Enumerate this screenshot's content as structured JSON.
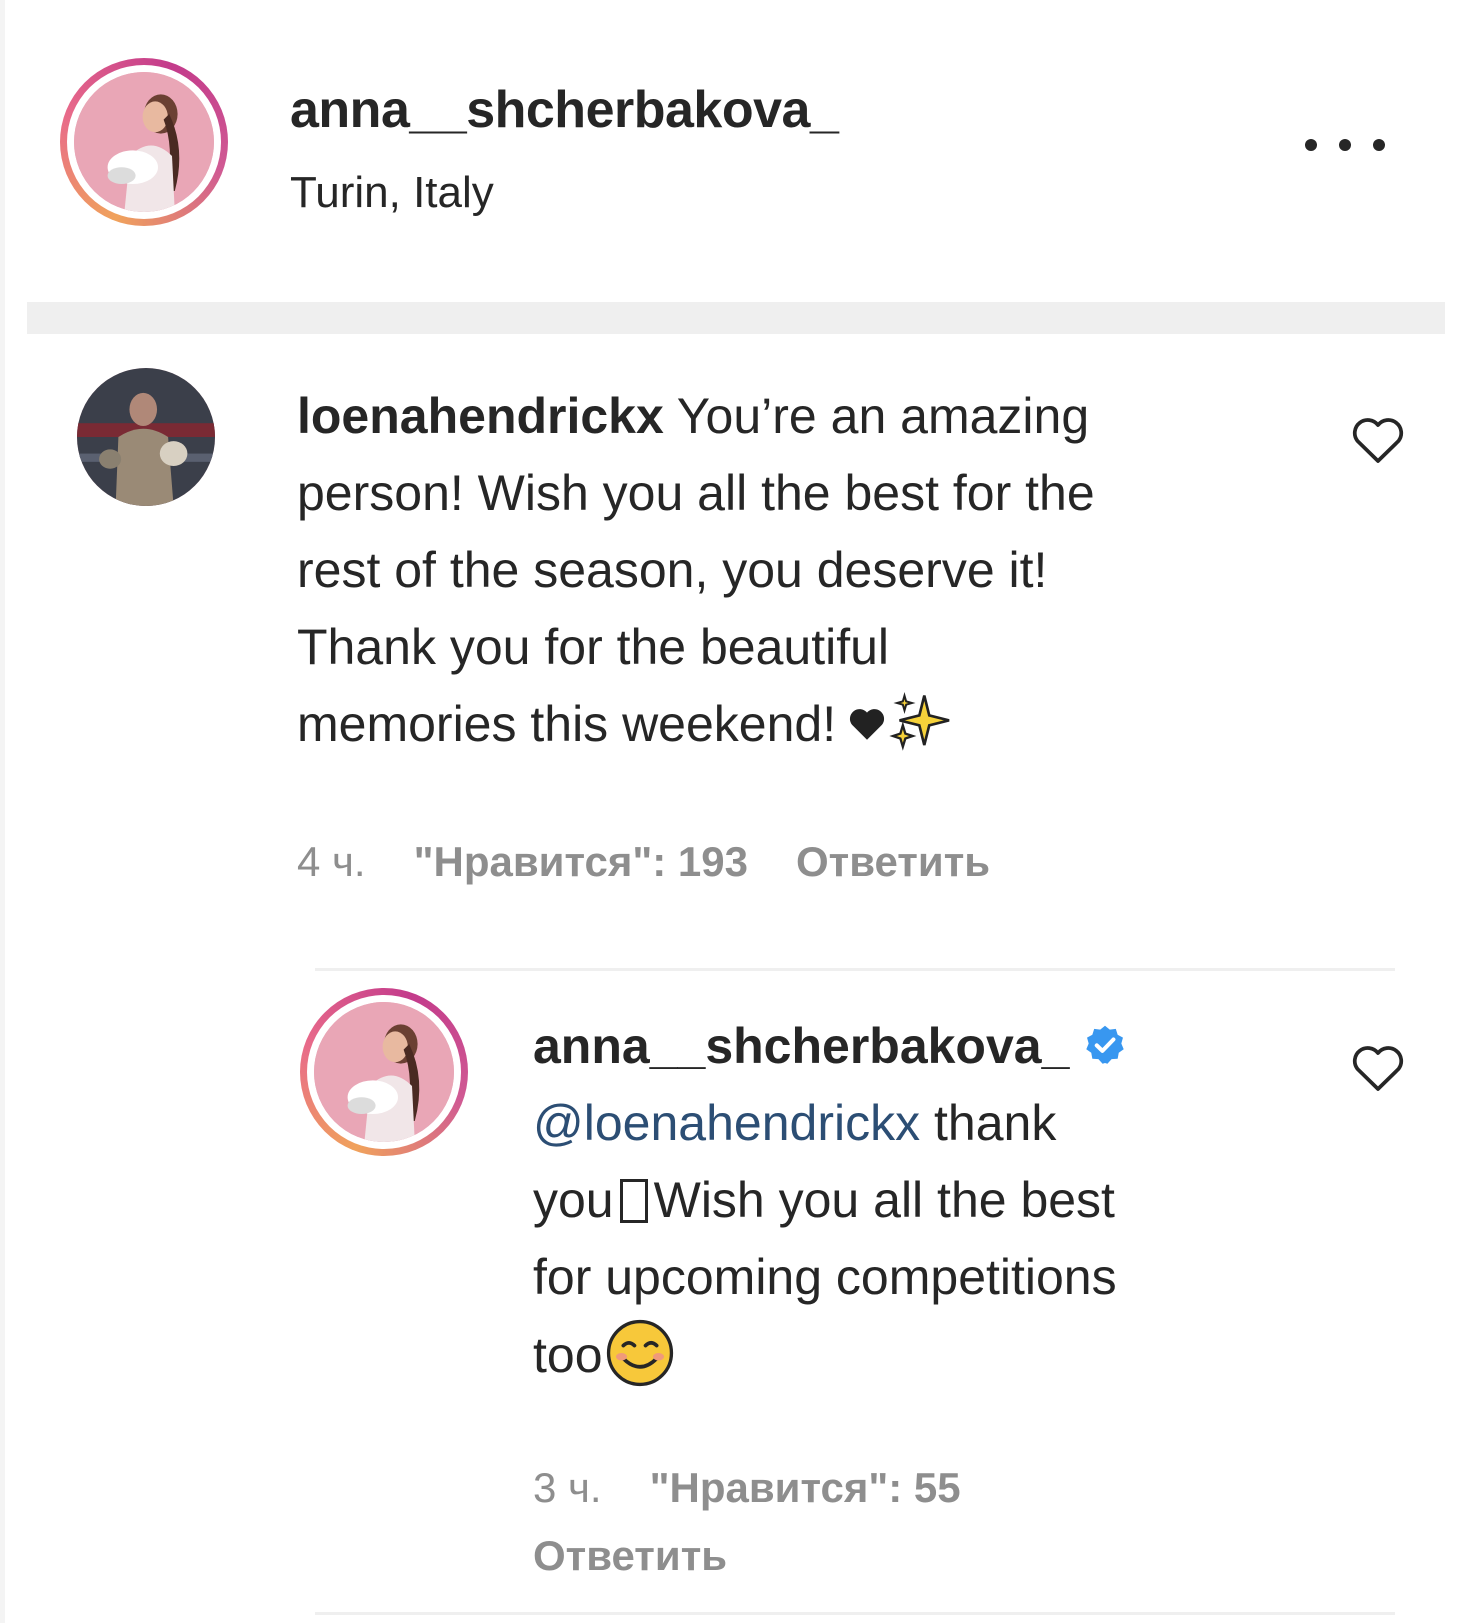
{
  "post": {
    "author": "anna__shcherbakova_",
    "location": "Turin, Italy",
    "more_icon": "more-horizontal-icon"
  },
  "comments": [
    {
      "username": "loenahendrickx",
      "text_lines": [
        "You’re an amazing",
        "person! Wish you all the best for the",
        "rest of the season, you deserve it!",
        "Thank you for the beautiful",
        "memories this weekend!"
      ],
      "emojis": [
        "black-heart-emoji",
        "sparkles-emoji"
      ],
      "time": "4 ч.",
      "likes": "\"Нравится\": 193",
      "reply_label": "Ответить",
      "like_icon": "heart-outline-icon"
    }
  ],
  "reply": {
    "username": "anna__shcherbakova_",
    "verified": true,
    "mention": "@loenahendrickx",
    "text_part1": "thank",
    "text_part2_a": "you",
    "text_part2_b": "Wish you all the best",
    "text_part3": "for upcoming competitions",
    "text_part4": "too",
    "emojis": [
      "missing-glyph-box",
      "smiling-face-emoji"
    ],
    "time": "3 ч.",
    "likes": "\"Нравится\": 55",
    "reply_label": "Ответить",
    "like_icon": "heart-outline-icon"
  },
  "colors": {
    "text": "#262626",
    "meta": "#8e8e8e",
    "mention": "#2c4e74",
    "verified": "#3897f0",
    "divider": "#efefef"
  }
}
